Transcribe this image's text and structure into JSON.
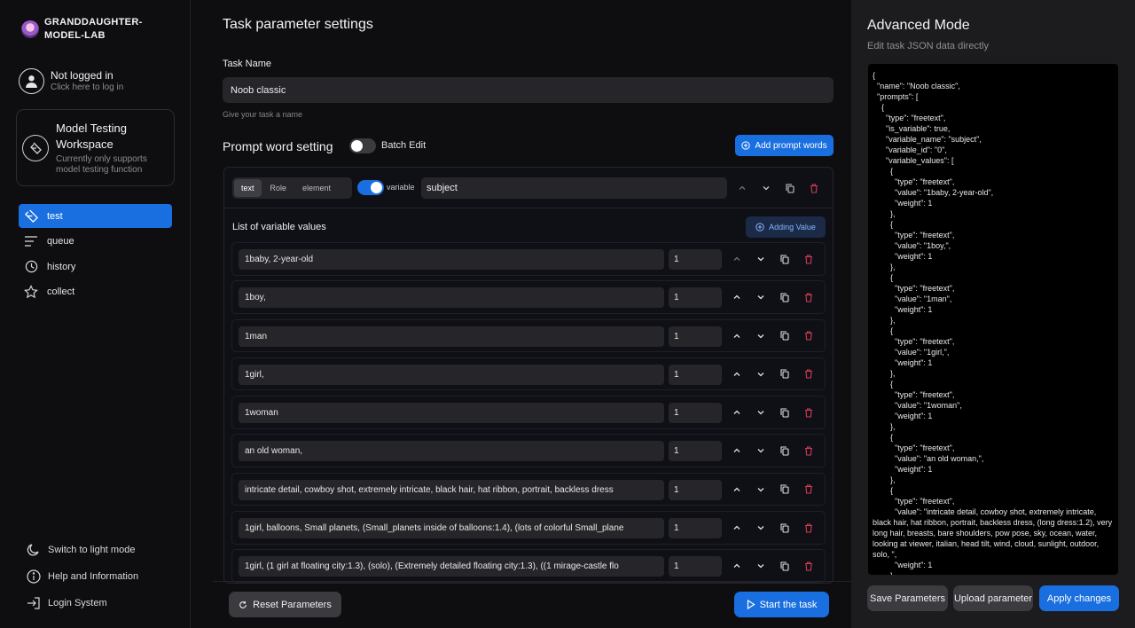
{
  "brand": {
    "name_line1": "GRANDDAUGHTER-",
    "name_line2": "MODEL-LAB"
  },
  "login": {
    "title": "Not logged in",
    "subtitle": "Click here to log in"
  },
  "workspace": {
    "title": "Model Testing Workspace",
    "subtitle": "Currently only supports model testing function"
  },
  "nav": [
    {
      "label": "test",
      "icon": "flask-icon",
      "active": true
    },
    {
      "label": "queue",
      "icon": "queue-icon",
      "active": false
    },
    {
      "label": "history",
      "icon": "history-icon",
      "active": false
    },
    {
      "label": "collect",
      "icon": "star-icon",
      "active": false
    }
  ],
  "bottom_links": [
    {
      "label": "Switch to light mode",
      "icon": "moon-icon"
    },
    {
      "label": "Help and Information",
      "icon": "info-icon"
    },
    {
      "label": "Login System",
      "icon": "login-icon"
    }
  ],
  "main": {
    "title": "Task parameter settings",
    "task_name_label": "Task Name",
    "task_name_value": "Noob classic",
    "task_name_hint": "Give your task a name",
    "prompt_title": "Prompt word setting",
    "batch_edit_label": "Batch Edit",
    "add_prompt_label": "Add prompt words",
    "segments": [
      "text",
      "Role",
      "element"
    ],
    "active_segment": "text",
    "variable_label": "variable",
    "variable_name": "subject",
    "list_title": "List of variable values",
    "add_value_label": "Adding Value",
    "values": [
      {
        "value": "1baby, 2-year-old",
        "weight": "1"
      },
      {
        "value": "1boy,",
        "weight": "1"
      },
      {
        "value": "1man",
        "weight": "1"
      },
      {
        "value": "1girl,",
        "weight": "1"
      },
      {
        "value": "1woman",
        "weight": "1"
      },
      {
        "value": "an old woman,",
        "weight": "1"
      },
      {
        "value": "intricate detail, cowboy shot, extremely intricate, black hair, hat ribbon, portrait, backless dress",
        "weight": "1"
      },
      {
        "value": "1girl, balloons, Small planets, (Small_planets inside of balloons:1.4), (lots of colorful Small_plane",
        "weight": "1"
      },
      {
        "value": "1girl, (1 girl at floating city:1.3), (solo), (Extremely detailed floating city:1.3), ((1 mirage-castle flo",
        "weight": "1"
      }
    ],
    "reset_label": "Reset Parameters",
    "start_label": "Start the task"
  },
  "advanced": {
    "title": "Advanced Mode",
    "subtitle": "Edit task JSON data directly",
    "json_text": "{\n  \"name\": \"Noob classic\",\n  \"prompts\": [\n    {\n      \"type\": \"freetext\",\n      \"is_variable\": true,\n      \"variable_name\": \"subject\",\n      \"variable_id\": \"0\",\n      \"variable_values\": [\n        {\n          \"type\": \"freetext\",\n          \"value\": \"1baby, 2-year-old\",\n          \"weight\": 1\n        },\n        {\n          \"type\": \"freetext\",\n          \"value\": \"1boy,\",\n          \"weight\": 1\n        },\n        {\n          \"type\": \"freetext\",\n          \"value\": \"1man\",\n          \"weight\": 1\n        },\n        {\n          \"type\": \"freetext\",\n          \"value\": \"1girl,\",\n          \"weight\": 1\n        },\n        {\n          \"type\": \"freetext\",\n          \"value\": \"1woman\",\n          \"weight\": 1\n        },\n        {\n          \"type\": \"freetext\",\n          \"value\": \"an old woman,\",\n          \"weight\": 1\n        },\n        {\n          \"type\": \"freetext\",\n          \"value\": \"intricate detail, cowboy shot, extremely intricate, black hair, hat ribbon, portrait, backless dress, (long dress:1.2), very long hair, breasts, bare shoulders, pow pose, sky, ocean, water, looking at viewer, italian, head tilt, wind, cloud, sunlight, outdoor,  solo, \",\n          \"weight\": 1\n        },",
    "save_label": "Save Parameters",
    "upload_label": "Upload parameter",
    "apply_label": "Apply changes"
  }
}
